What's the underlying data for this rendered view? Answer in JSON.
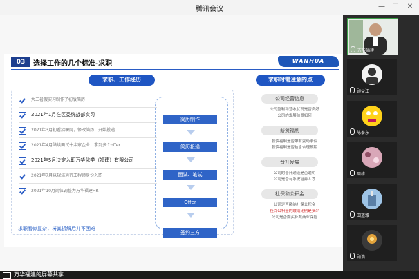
{
  "window": {
    "title": "腾讯会议"
  },
  "slide": {
    "section_no": "03",
    "section_title": "选择工作的几个标准-求职",
    "logo_text": "WANHUA",
    "left_header": "求职、工作经历",
    "right_header": "求职时需注意的点",
    "experience": [
      {
        "text": "大二暑假实习制作了初版简历",
        "strong": false
      },
      {
        "text": "2021年1月在区委统战部实习",
        "strong": true
      },
      {
        "text": "2021年3月初看招聘网，修改简历，开始投递",
        "strong": false
      },
      {
        "text": "2021年4月陆续面试十余家企业，拿到多个offer",
        "strong": false
      },
      {
        "text": "2021年5月决定入职万华化学（福建）有限公司",
        "strong": true
      },
      {
        "text": "2021年7月以规培运行工程师身份入职",
        "strong": false
      },
      {
        "text": "2021年10月岗位调整为万华福建HR",
        "strong": false
      }
    ],
    "steps": [
      "简历制作",
      "简历投递",
      "面试、笔试",
      "Offer",
      "签约三方"
    ],
    "bottom_note": "求职看似复杂，将其拆解后并不困难",
    "right_sections": [
      {
        "title": "公司经营信息",
        "lines": [
          {
            "text": "公司盈利和营收状况是否良好",
            "red": false
          },
          {
            "text": "公司的发展前景如何",
            "red": false
          }
        ]
      },
      {
        "title": "薪资福利",
        "lines": [
          {
            "text": "薪资福利是否带有变动条件",
            "red": false
          },
          {
            "text": "薪资福利是否包含合理预期",
            "red": false
          }
        ]
      },
      {
        "title": "晋升发展",
        "lines": [
          {
            "text": "公司的晋升通道是否透明",
            "red": false
          },
          {
            "text": "公司是否有系统培养人才",
            "red": false
          }
        ]
      },
      {
        "title": "社保和公积金",
        "lines": [
          {
            "text": "公司是否缴纳社保公积金",
            "red": false
          },
          {
            "text": "社保公积金的缴纳比例是多少",
            "red": true
          },
          {
            "text": "公司是否购买补充商业保险",
            "red": false
          }
        ]
      }
    ]
  },
  "participants": [
    {
      "name": "万华福建"
    },
    {
      "name": "顾益江"
    },
    {
      "name": "陈泰东"
    },
    {
      "name": "周维"
    },
    {
      "name": "田道雅"
    },
    {
      "name": "顾浩"
    }
  ],
  "bottom": {
    "share_text": "万华福建的屏幕共享"
  },
  "colors": {
    "brand_blue": "#1f56c3",
    "dark_navy": "#1d3f8f",
    "warning_red": "#d12a2a"
  }
}
